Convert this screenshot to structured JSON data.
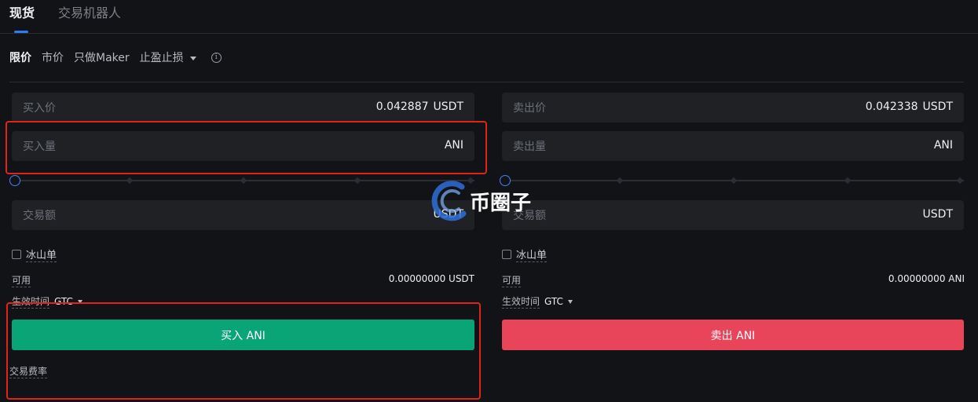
{
  "tabs": [
    {
      "label": "现货",
      "active": true
    },
    {
      "label": "交易机器人",
      "active": false
    }
  ],
  "order_types": {
    "limit": "限价",
    "market": "市价",
    "maker_only": "只做Maker",
    "tp_sl": "止盈止损",
    "info_symbol": "i"
  },
  "buy": {
    "price_label": "买入价",
    "price_value": "0.042887",
    "price_unit": "USDT",
    "amount_label": "买入量",
    "amount_value": "",
    "amount_unit": "ANI",
    "total_label": "交易额",
    "total_value": "",
    "total_unit": "USDT",
    "slider_percent": 0,
    "iceberg_label": "冰山单",
    "available_label": "可用",
    "available_value": "0.00000000 USDT",
    "tif_label": "生效时间",
    "tif_value": "GTC",
    "button_label": "买入 ANI",
    "fee_label": "交易费率"
  },
  "sell": {
    "price_label": "卖出价",
    "price_value": "0.042338",
    "price_unit": "USDT",
    "amount_label": "卖出量",
    "amount_value": "",
    "amount_unit": "ANI",
    "total_label": "交易额",
    "total_value": "",
    "total_unit": "USDT",
    "slider_percent": 0,
    "iceberg_label": "冰山单",
    "available_label": "可用",
    "available_value": "0.00000000 ANI",
    "tif_label": "生效时间",
    "tif_value": "GTC",
    "button_label": "卖出 ANI"
  },
  "watermark": {
    "text": "币圈子"
  },
  "colors": {
    "background": "#121316",
    "input_bg": "#1f2125",
    "accent_blue": "#2f7bf5",
    "buy_green": "#0aa577",
    "sell_red": "#e8445a",
    "highlight_red": "#e0241c"
  }
}
